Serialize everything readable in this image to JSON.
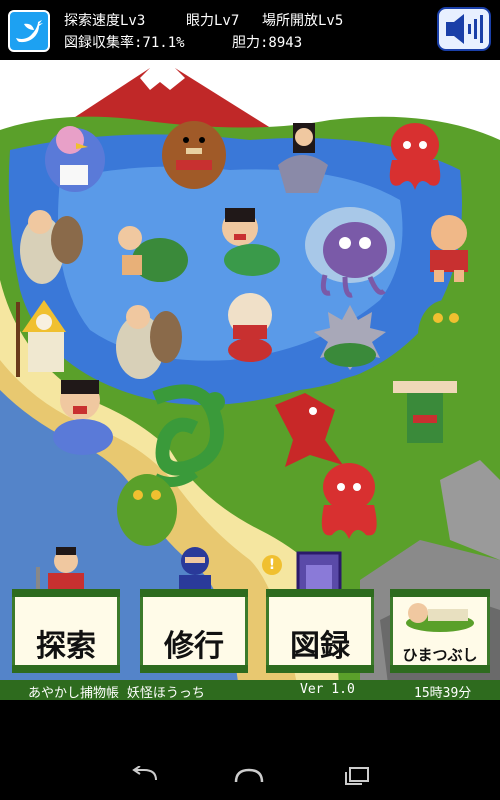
{
  "hud": {
    "explore_speed": "探索速度Lv3",
    "eye_power": "眼力Lv7",
    "area_unlock": "場所開放Lv5",
    "collection_rate": "図録収集率:71.1%",
    "courage": "胆力:8943"
  },
  "icons": {
    "twitter": "twitter-bird-icon",
    "sound": "speaker-icon"
  },
  "buttons": {
    "explore": "探索",
    "training": "修行",
    "catalog": "図録",
    "kill_time": "ひまつぶし",
    "catalog_badge": "!"
  },
  "footer": {
    "title": "あやかし捕物帳 妖怪ほうっち",
    "version": "Ver 1.0",
    "time": "15時39分"
  },
  "colors": {
    "sea": "#3a78d8",
    "sand": "#f5e6a0",
    "grass": "#5aa02a",
    "sky": "#ffffff",
    "mountain": "#c02828",
    "footer_bg": "#2e6b1e"
  },
  "monsters": [
    "blue-feathered-tengu",
    "bear-sumo",
    "mermaid-woman",
    "red-octopus",
    "old-man-sack",
    "kappa-turtle",
    "rokurokubi-woman",
    "purple-tentacle-blob",
    "baby-oni",
    "tengu-yellow",
    "old-man-sack-2",
    "hannya-mask",
    "grey-spiky-blob",
    "green-kappa",
    "laughing-woman",
    "green-dragon",
    "red-wolf",
    "hammerhead-kappa",
    "green-imp",
    "red-octopus-2"
  ]
}
